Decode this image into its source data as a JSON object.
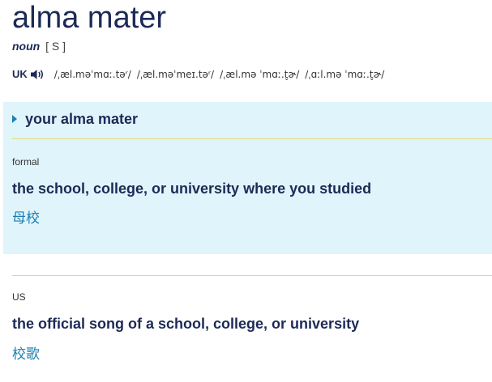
{
  "entry": {
    "headword": "alma mater",
    "part_of_speech": "noun",
    "grammar": "[ S ]",
    "pronunciation": {
      "region": "UK",
      "icon": "speaker-icon",
      "variants": [
        "/ˌæl.məˈmɑː.təʳ/",
        "/ˌæl.məˈmeɪ.təʳ/",
        "/ˌæl.mə ˈmɑː.t̬ɚ/",
        "/ˌɑːl.mə ˈmɑː.t̬ɚ/"
      ]
    }
  },
  "idiom": {
    "phrase": "your alma mater",
    "accent_color": "#1a80b0",
    "panel_color": "#dff5fb"
  },
  "senses": [
    {
      "label": "formal",
      "definition": "the school, college, or university where you studied",
      "translation": "母校"
    },
    {
      "label": "US",
      "definition": "the official song of a school, college, or university",
      "translation": "校歌"
    }
  ]
}
